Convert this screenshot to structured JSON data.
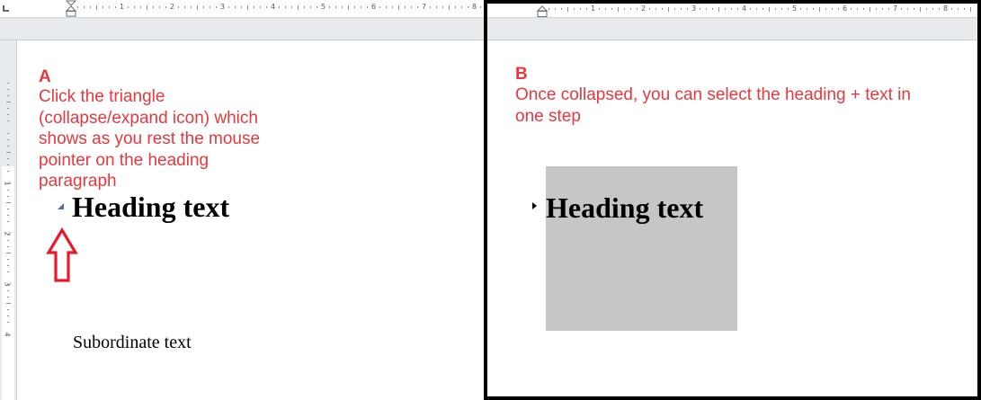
{
  "colors": {
    "annotation": "#e8383d",
    "arrow": "#e8192c",
    "triangle_expanded": "#4a6fa5",
    "triangle_collapsed": "#000000",
    "selection": "#c6c6c6",
    "ruler_band": "#e7ebee"
  },
  "panel_a": {
    "ruler_numbers": [
      "1",
      "2",
      "3",
      "4",
      "5",
      "6",
      "7",
      "8"
    ],
    "vertical_ruler_numbers": [
      "1",
      "2",
      "3",
      "4"
    ],
    "label": "A",
    "note_lines": [
      "Click the triangle",
      "(collapse/expand icon) which",
      "shows as you rest the mouse",
      "pointer on the heading",
      "paragraph"
    ],
    "heading": "Heading text",
    "subordinate": "Subordinate text",
    "icons": {
      "tab_stop": "left-tab-icon",
      "indent": "indent-marker-icon",
      "collapse": "collapse-triangle-icon",
      "arrow": "up-arrow-icon"
    }
  },
  "panel_b": {
    "ruler_numbers": [
      "1",
      "2",
      "3",
      "4",
      "5",
      "6",
      "7",
      "8"
    ],
    "label": "B",
    "note_lines": [
      "Once collapsed, you can select the heading + text in",
      "one step"
    ],
    "heading": "Heading text",
    "icons": {
      "indent": "indent-marker-icon",
      "expand": "expand-triangle-icon"
    }
  }
}
